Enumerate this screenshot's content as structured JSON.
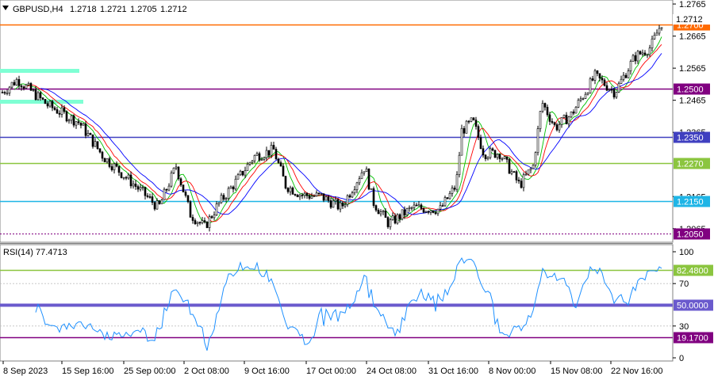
{
  "symbol_header": {
    "menu_icon": "triangle-down-icon",
    "symbol": "GBPUSD,H4",
    "open": "1.2718",
    "high": "1.2721",
    "low": "1.2705",
    "close": "1.2712"
  },
  "price_axis": {
    "ticks": [
      "1.2765",
      "1.2665",
      "1.2565",
      "1.2465",
      "1.2365",
      "1.2165",
      "1.2065"
    ],
    "current_price_label": "1.2712",
    "levels": [
      {
        "label": "1.2700",
        "price": 1.27,
        "color": "#ff6a00"
      },
      {
        "label": "1.2500",
        "price": 1.25,
        "color": "#800080"
      },
      {
        "label": "1.2350",
        "price": 1.235,
        "color": "#4040c0"
      },
      {
        "label": "1.2270",
        "price": 1.227,
        "color": "#8bc53f"
      },
      {
        "label": "1.2150",
        "price": 1.215,
        "color": "#1fb5e6"
      },
      {
        "label": "1.2050",
        "price": 1.205,
        "color": "#800080"
      }
    ],
    "range": [
      1.2025,
      1.2775
    ]
  },
  "rsi_panel": {
    "title": "RSI(14) 77.4713",
    "ticks": [
      "100",
      "70",
      "30",
      "0"
    ],
    "levels": [
      {
        "label": "82.4800",
        "value": 82.48,
        "color": "#8bc53f"
      },
      {
        "label": "50.0000",
        "value": 50.0,
        "color": "#6a5acd"
      },
      {
        "label": "19.1700",
        "value": 19.17,
        "color": "#800080"
      }
    ]
  },
  "time_axis": {
    "labels": [
      "8 Sep 2023",
      "15 Sep 16:00",
      "25 Sep 00:00",
      "2 Oct 08:00",
      "9 Oct 16:00",
      "17 Oct 00:00",
      "24 Oct 08:00",
      "31 Oct 16:00",
      "8 Nov 00:00",
      "15 Nov 08:00",
      "22 Nov 16:00"
    ]
  },
  "colors": {
    "candle": "#000000",
    "ma_fast": "#00c000",
    "ma_mid": "#ff0000",
    "ma_slow": "#0000ff",
    "rsi_line": "#1e90ff",
    "zone": "#7fffd4"
  },
  "chart_data": {
    "type": "line",
    "title": "GBPUSD,H4",
    "x": [
      "8 Sep 2023",
      "15 Sep 16:00",
      "25 Sep 00:00",
      "2 Oct 08:00",
      "9 Oct 16:00",
      "17 Oct 00:00",
      "24 Oct 08:00",
      "31 Oct 16:00",
      "8 Nov 00:00",
      "15 Nov 08:00",
      "22 Nov 16:00"
    ],
    "series": [
      {
        "name": "GBPUSD,H4",
        "values": [
          1.249,
          1.2395,
          1.214,
          1.211,
          1.225,
          1.2165,
          1.212,
          1.226,
          1.233,
          1.246,
          1.2712
        ]
      },
      {
        "name": "RSI(14)",
        "values": [
          46,
          50,
          26,
          44,
          55,
          45,
          49,
          60,
          50,
          66,
          77.4713
        ]
      }
    ],
    "ylim": [
      1.2025,
      1.2775
    ],
    "grid": false
  }
}
